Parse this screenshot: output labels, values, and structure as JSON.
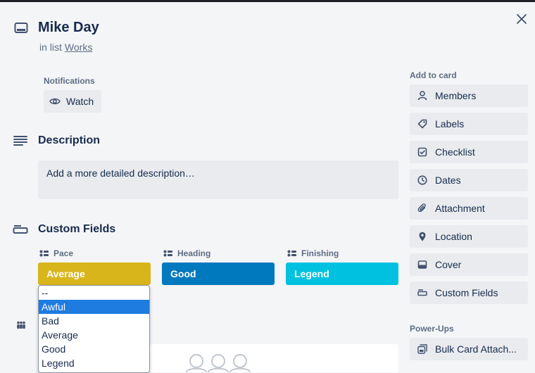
{
  "card": {
    "title": "Mike Day",
    "in_list_prefix": "in list",
    "list_name": "Works"
  },
  "notifications": {
    "heading": "Notifications",
    "watch_label": "Watch"
  },
  "description": {
    "title": "Description",
    "placeholder": "Add a more detailed description…"
  },
  "custom_fields": {
    "title": "Custom Fields",
    "fields": [
      {
        "label": "Pace",
        "value": "Average",
        "color": "#d9b51c"
      },
      {
        "label": "Heading",
        "value": "Good",
        "color": "#0079bf"
      },
      {
        "label": "Finishing",
        "value": "Legend",
        "color": "#00c2e0"
      }
    ],
    "dropdown_options": [
      "--",
      "Awful",
      "Bad",
      "Average",
      "Good",
      "Legend"
    ],
    "dropdown_selected": "Awful"
  },
  "sidebar": {
    "add_to_card_heading": "Add to card",
    "items": [
      {
        "label": "Members",
        "icon": "person-icon"
      },
      {
        "label": "Labels",
        "icon": "tag-icon"
      },
      {
        "label": "Checklist",
        "icon": "checkbox-icon"
      },
      {
        "label": "Dates",
        "icon": "clock-icon"
      },
      {
        "label": "Attachment",
        "icon": "paperclip-icon"
      },
      {
        "label": "Location",
        "icon": "pin-icon"
      },
      {
        "label": "Cover",
        "icon": "cover-icon"
      },
      {
        "label": "Custom Fields",
        "icon": "custom-fields-icon"
      }
    ],
    "powerups_heading": "Power-Ups",
    "powerups": [
      {
        "label": "Bulk Card Attach...",
        "icon": "bulk-attach-icon"
      }
    ]
  },
  "colors": {
    "accent": "#0079bf",
    "dropdown_highlight": "#1e7be0",
    "button_bg": "#e9ebee",
    "page_bg": "#f4f5f7"
  }
}
